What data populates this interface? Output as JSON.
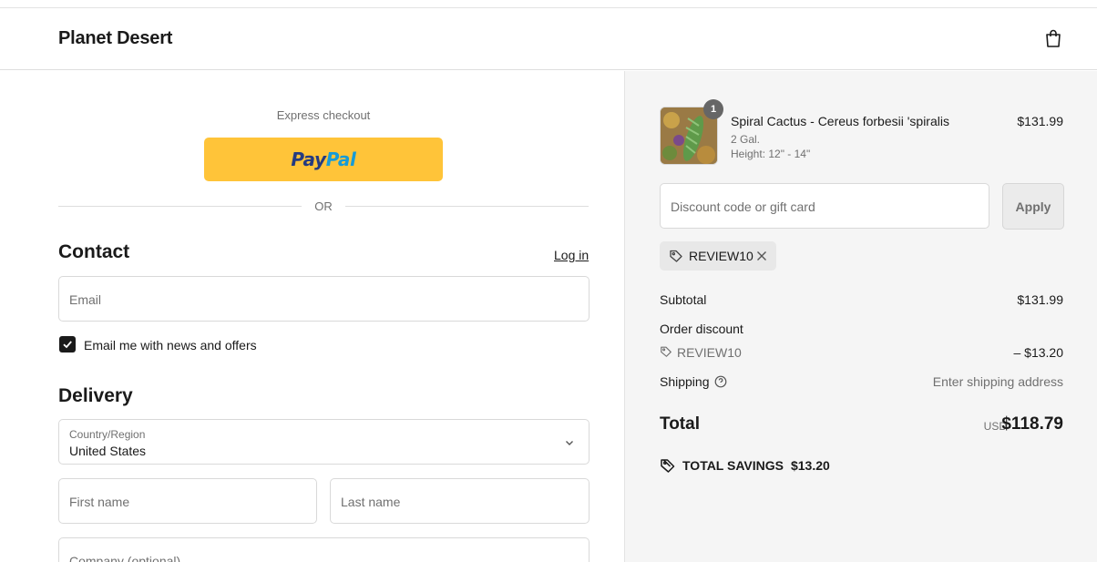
{
  "header": {
    "store_name": "Planet Desert",
    "cart_icon": "shopping-bag-icon"
  },
  "checkout": {
    "express_label": "Express checkout",
    "paypal": {
      "pay": "Pay",
      "pal": "Pal",
      "color": "#ffc439"
    },
    "or_text": "OR",
    "contact": {
      "title": "Contact",
      "login_link": "Log in",
      "email_placeholder": "Email",
      "newsletter_label": "Email me with news and offers",
      "newsletter_checked": true
    },
    "delivery": {
      "title": "Delivery",
      "country_label": "Country/Region",
      "country_value": "United States",
      "first_name_placeholder": "First name",
      "last_name_placeholder": "Last name",
      "company_placeholder": "Company (optional)"
    }
  },
  "order_summary": {
    "item": {
      "quantity": "1",
      "name": "Spiral Cactus - Cereus forbesii 'spiralis",
      "variant_size": "2 Gal.",
      "variant_height": "Height: 12\" - 14\"",
      "price": "$131.99"
    },
    "discount_placeholder": "Discount code or gift card",
    "apply_label": "Apply",
    "applied_code": "REVIEW10",
    "subtotal_label": "Subtotal",
    "subtotal_value": "$131.99",
    "order_discount_label": "Order discount",
    "discount_code": "REVIEW10",
    "discount_value": "– $13.20",
    "shipping_label": "Shipping",
    "shipping_value": "Enter shipping address",
    "total_label": "Total",
    "currency": "USD",
    "total_value": "$118.79",
    "savings_label": "TOTAL SAVINGS",
    "savings_value": "$13.20"
  }
}
